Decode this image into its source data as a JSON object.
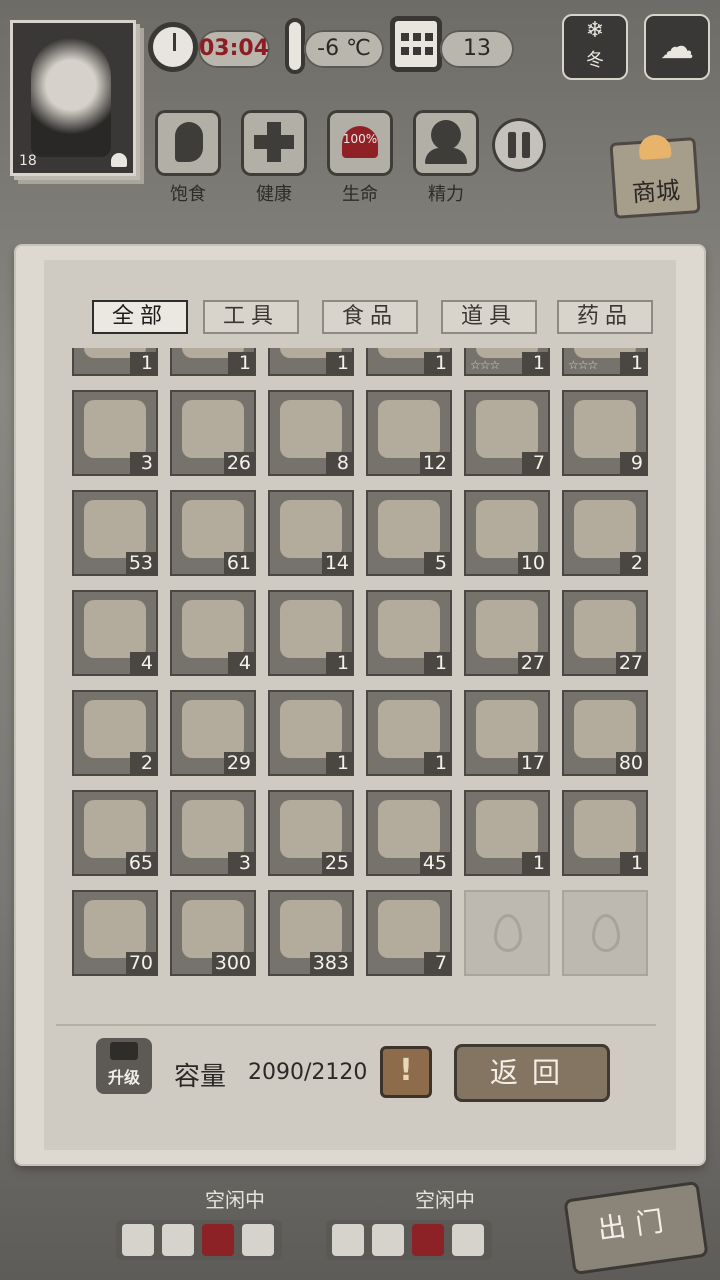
{
  "status": {
    "level": "18",
    "time": "03:04",
    "temperature": "-6 ℃",
    "day": "13",
    "season": "冬"
  },
  "stats": [
    {
      "label": "饱食",
      "icon": "stomach-icon"
    },
    {
      "label": "健康",
      "icon": "plus-icon"
    },
    {
      "label": "生命",
      "icon": "heart-icon",
      "value": "100%"
    },
    {
      "label": "精力",
      "icon": "person-icon"
    }
  ],
  "shop": {
    "label": "商城"
  },
  "tabs": [
    "全部",
    "工具",
    "食品",
    "道具",
    "药品"
  ],
  "items": [
    {
      "name": "shield-item",
      "count": "1"
    },
    {
      "name": "shield-item",
      "count": "1"
    },
    {
      "name": "shield-item",
      "count": "1"
    },
    {
      "name": "shield-item",
      "count": "1"
    },
    {
      "name": "round-shield-item",
      "count": "1",
      "stars": "☆☆☆"
    },
    {
      "name": "round-shield-item",
      "count": "1",
      "stars": "☆☆☆"
    },
    {
      "name": "sticks-item",
      "count": "3"
    },
    {
      "name": "rope-item",
      "count": "26"
    },
    {
      "name": "leaf-item",
      "count": "8"
    },
    {
      "name": "water-puddle-item",
      "count": "12"
    },
    {
      "name": "wheat-item",
      "count": "7"
    },
    {
      "name": "wood-planks-item",
      "count": "9"
    },
    {
      "name": "board-item",
      "count": "53"
    },
    {
      "name": "nail-item",
      "count": "61"
    },
    {
      "name": "arrows-item",
      "count": "14"
    },
    {
      "name": "ore-item",
      "count": "5"
    },
    {
      "name": "coal-item",
      "count": "10"
    },
    {
      "name": "stone-item",
      "count": "2"
    },
    {
      "name": "worm-item",
      "count": "4"
    },
    {
      "name": "feather-item",
      "count": "4"
    },
    {
      "name": "basket-item",
      "count": "1"
    },
    {
      "name": "fish-glue-item",
      "count": "1"
    },
    {
      "name": "salt-powder-item",
      "count": "27"
    },
    {
      "name": "mushroom-item",
      "count": "27"
    },
    {
      "name": "chest-item",
      "count": "2"
    },
    {
      "name": "bottle-item",
      "count": "29"
    },
    {
      "name": "sword-item",
      "count": "1"
    },
    {
      "name": "necklace-item",
      "count": "1"
    },
    {
      "name": "wood-log-item",
      "count": "17"
    },
    {
      "name": "supply-box-item",
      "count": "80"
    },
    {
      "name": "medical-box-item",
      "count": "65"
    },
    {
      "name": "tool-box-item",
      "count": "3"
    },
    {
      "name": "hammer-box-item",
      "count": "25"
    },
    {
      "name": "craft-box-item",
      "count": "45"
    },
    {
      "name": "fishing-rod-item",
      "count": "1"
    },
    {
      "name": "fishing-rod-item",
      "count": "1"
    },
    {
      "name": "earthworm-item",
      "count": "70"
    },
    {
      "name": "eel-item",
      "count": "300"
    },
    {
      "name": "shrimp-item",
      "count": "383"
    },
    {
      "name": "fish-item",
      "count": "7"
    },
    {
      "name": "empty-slot",
      "count": ""
    },
    {
      "name": "empty-slot",
      "count": ""
    }
  ],
  "footer": {
    "upgrade_label": "升级",
    "capacity_label": "容量",
    "capacity_value": "2090/2120",
    "warning": "!",
    "back_label": "返回"
  },
  "bottom": {
    "idle1": "空闲中",
    "idle2": "空闲中",
    "exit_label": "出门"
  }
}
